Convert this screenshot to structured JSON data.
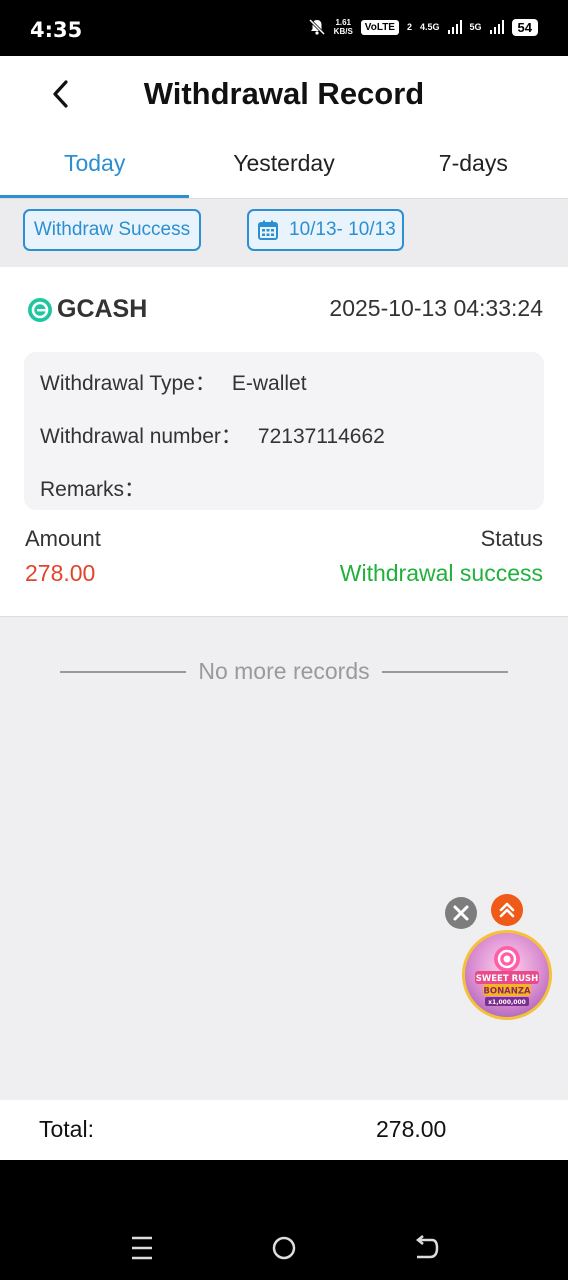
{
  "status_bar": {
    "time": "4:35",
    "speed_value": "1.61",
    "speed_unit": "KB/S",
    "volte": "VoLTE",
    "sim_index": "2",
    "network_1": "4.5G",
    "network_2": "5G",
    "battery": "54"
  },
  "header": {
    "title": "Withdrawal Record",
    "back_icon": "chevron-left-icon"
  },
  "tabs": [
    {
      "label": "Today",
      "active": true
    },
    {
      "label": "Yesterday",
      "active": false
    },
    {
      "label": "7-days",
      "active": false
    }
  ],
  "filters": {
    "status_label": "Withdraw Success",
    "date_range": "10/13- 10/13",
    "date_icon": "calendar-icon"
  },
  "record": {
    "brand": "GCASH",
    "datetime": "2025-10-13 04:33:24",
    "type_label": "Withdrawal Type：",
    "type_value": "E-wallet",
    "number_label": "Withdrawal number：",
    "number_value": "72137114662",
    "remarks_label": "Remarks：",
    "remarks_value": "",
    "amount_label": "Amount",
    "amount_value": "278.00",
    "status_label": "Status",
    "status_value": "Withdrawal success"
  },
  "list_end": "No more records",
  "floating": {
    "game_title_1": "SWEET RUSH",
    "game_title_2": "BONANZA",
    "game_prize": "x1,000,000"
  },
  "footer": {
    "total_label": "Total:",
    "total_value": "278.00"
  },
  "colors": {
    "accent": "#2b8fd1",
    "amount": "#e2452b",
    "success": "#20b13c",
    "gcash": "#1fc7a0"
  }
}
